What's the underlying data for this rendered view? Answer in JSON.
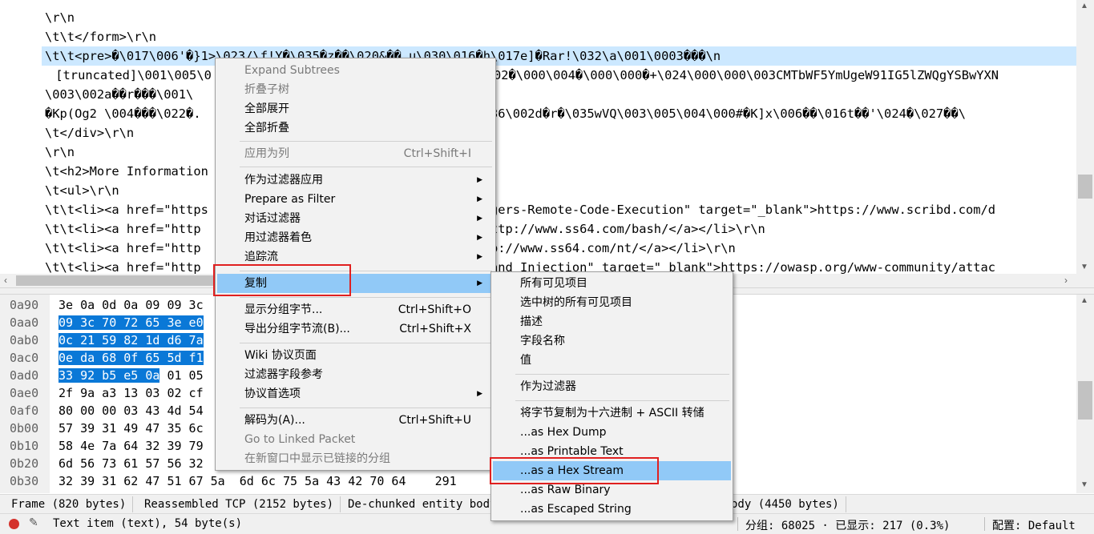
{
  "details": {
    "lines": [
      "\\r\\n",
      "\\t\\t</form>\\r\\n",
      "\\t\\t<pre>�\\017\\006'�}1>\\023/\\f!Y�\\035�z��\\020&�� u\\030\\016�h\\017e]�Rar!\\032\\a\\001\\0003���\\n",
      " [truncated]\\001\\005\\0                                 \\03\\002�\\000\\004�\\000\\000�+\\024\\000\\000\\003CMTbWF5YmUgeW91IG5lZWQgYSBwYXN",
      "\\003\\002a��r���\\001\\",
      "�Kp(Og2 \\004���\\022�.                                \\022�\\036\\002d�r�\\035wVQ\\003\\005\\004\\000#�K]x\\006��\\016t��'\\024�\\027��\\",
      "\\t</div>\\r\\n",
      "\\r\\n",
      "\\t<h2>More Information",
      "\\t<ul>\\r\\n",
      "\\t\\t<li><a href=\"https                                 Endangers-Remote-Code-Execution\" target=\"_blank\">https://www.scribd.com/d",
      "\\t\\t<li><a href=\"http                                  nk\">http://www.ss64.com/bash/</a></li>\\r\\n",
      "\\t\\t<li><a href=\"http                                  \">http://www.ss64.com/nt/</a></li>\\r\\n",
      "\\t\\t<li><a href=\"http                                  /Command_Injection\" target=\"_blank\">https://owasp.org/www-community/attac"
    ]
  },
  "bytes": {
    "rows": [
      {
        "off": "0a90",
        "hex": "3e 0a 0d 0a 09 09 3c",
        "sel": false
      },
      {
        "off": "0aa0",
        "hex": "09 3c 70 72 65 3e e0",
        "sel": true
      },
      {
        "off": "0ab0",
        "hex": "0c 21 59 82 1d d6 7a",
        "sel": true
      },
      {
        "off": "0ac0",
        "hex": "0e da 68 0f 65 5d f1",
        "sel": true
      },
      {
        "off": "0ad0",
        "hex": "33 92 b5 e5 0a",
        "rest": " 01 05",
        "sel": true
      },
      {
        "off": "0ae0",
        "hex": "2f 9a a3 13 03 02 cf",
        "sel": false
      },
      {
        "off": "0af0",
        "hex": "80 00 00 03 43 4d 54",
        "sel": false
      },
      {
        "off": "0b00",
        "hex": "57 39 31 49 47 35 6c",
        "sel": false
      },
      {
        "off": "0b10",
        "hex": "58 4e 7a 64 32 39 79",
        "sel": false
      },
      {
        "off": "0b20",
        "hex": "6d 56 73 61 57 56 32",
        "sel": false
      },
      {
        "off": "0b30",
        "hex": "32 39 31 62 47 51 67 5a  6d 6c 75 5a 43 42 70 64    291",
        "sel": false
      }
    ]
  },
  "tabs": [
    "Frame (820 bytes)",
    "Reassembled TCP (2152 bytes)",
    "De-chunked entity body",
    "ody (4450 bytes)"
  ],
  "status": {
    "item": "Text item (text), 54 byte(s)",
    "packets": "分组: 68025 · 已显示: 217 (0.3%)",
    "profile": "配置: Default"
  },
  "menu1": {
    "items": [
      {
        "label": "Expand Subtrees",
        "disabled": true
      },
      {
        "label": "折叠子树",
        "disabled": true
      },
      {
        "label": "全部展开"
      },
      {
        "label": "全部折叠"
      },
      {
        "label": "应用为列",
        "shortcut": "Ctrl+Shift+I",
        "disabled": true
      },
      {
        "label": "作为过滤器应用",
        "submenu": true
      },
      {
        "label": "Prepare as Filter",
        "submenu": true
      },
      {
        "label": "对话过滤器",
        "submenu": true
      },
      {
        "label": "用过滤器着色",
        "submenu": true
      },
      {
        "label": "追踪流",
        "submenu": true
      },
      {
        "label": "复制",
        "submenu": true,
        "hot": true
      },
      {
        "label": "显示分组字节...",
        "shortcut": "Ctrl+Shift+O"
      },
      {
        "label": "导出分组字节流(B)...",
        "shortcut": "Ctrl+Shift+X"
      },
      {
        "label": "Wiki 协议页面"
      },
      {
        "label": "过滤器字段参考"
      },
      {
        "label": "协议首选项",
        "submenu": true
      },
      {
        "label": "解码为(A)...",
        "shortcut": "Ctrl+Shift+U"
      },
      {
        "label": "Go to Linked Packet",
        "disabled": true
      },
      {
        "label": "在新窗口中显示已链接的分组",
        "disabled": true
      }
    ]
  },
  "menu2": {
    "items": [
      {
        "label": "所有可见项目"
      },
      {
        "label": "选中树的所有可见项目"
      },
      {
        "label": "描述"
      },
      {
        "label": "字段名称"
      },
      {
        "label": "值"
      },
      {
        "label": "作为过滤器"
      },
      {
        "label": "将字节复制为十六进制 + ASCII 转储"
      },
      {
        "label": "...as Hex Dump"
      },
      {
        "label": "...as Printable Text"
      },
      {
        "label": "...as a Hex Stream",
        "hot": true
      },
      {
        "label": "...as Raw Binary"
      },
      {
        "label": "...as Escaped String"
      }
    ]
  },
  "colors": {
    "selection_row": "#cce8ff",
    "byte_highlight": "#0a78d7",
    "menu_hover": "#91c9f7",
    "callout_box": "#e02020",
    "capture_stopped_dot": "#d4322c"
  }
}
